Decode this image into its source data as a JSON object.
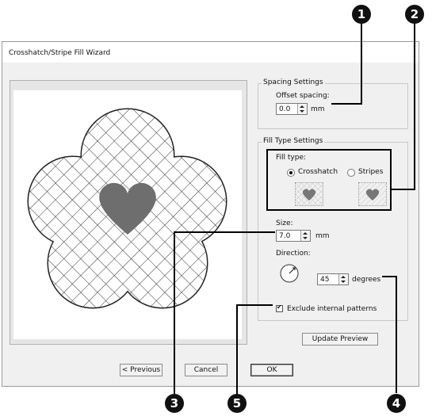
{
  "window": {
    "title": "Crosshatch/Stripe Fill Wizard"
  },
  "spacing": {
    "group_label": "Spacing Settings",
    "offset_label": "Offset spacing:",
    "offset_value": "0.0",
    "offset_unit": "mm"
  },
  "filltype": {
    "group_label": "Fill Type Settings",
    "type_label": "Fill type:",
    "options": [
      "Crosshatch",
      "Stripes"
    ],
    "selected": "Crosshatch",
    "size_label": "Size:",
    "size_value": "7.0",
    "size_unit": "mm",
    "direction_label": "Direction:",
    "direction_value": "45",
    "direction_unit": "degrees",
    "exclude_label": "Exclude internal patterns",
    "exclude_checked": true
  },
  "buttons": {
    "update_preview": "Update Preview",
    "previous": "< Previous",
    "cancel": "Cancel",
    "ok": "OK"
  },
  "callouts": [
    "1",
    "2",
    "3",
    "4",
    "5"
  ],
  "colors": {
    "heart": "#6e6e6e",
    "outline": "#222222"
  }
}
